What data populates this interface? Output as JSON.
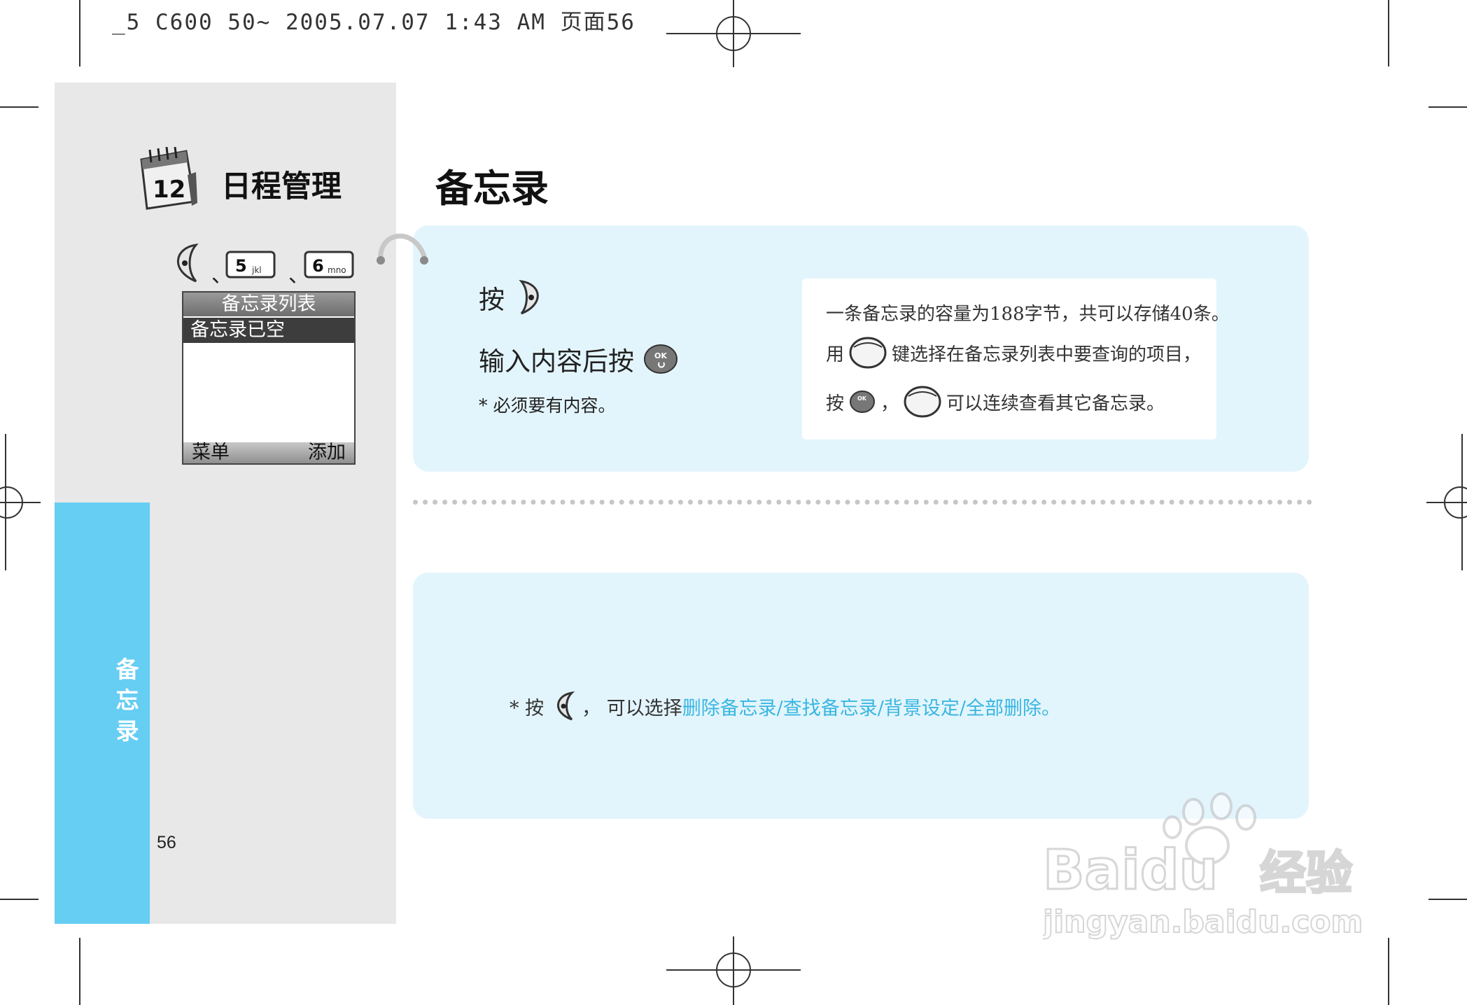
{
  "print_header": "_5 C600 50~ 2005.07.07 1:43 AM 页面56",
  "sidebar": {
    "section_title": "日程管理",
    "calendar_day": "12",
    "tab_label": "备\n忘\n录",
    "page_number": "56",
    "key_sequence": {
      "key1_digit": "5",
      "key1_letters": "jkl",
      "key2_digit": "6",
      "key2_letters": "mno",
      "separator": "、"
    }
  },
  "phone_screen": {
    "title": "备忘录列表",
    "selected_item": "备忘录已空",
    "soft_left": "菜单",
    "soft_right": "添加"
  },
  "main": {
    "title": "备忘录",
    "step1_prefix": "按",
    "step2_prefix": "输入内容后按",
    "note_required": "* 必须要有内容。",
    "ok_label": "OK",
    "info": {
      "line1": "一条备忘录的容量为188字节，共可以存储40条。",
      "line2_prefix": "用",
      "line2_suffix": "键选择在备忘录列表中要查询的项目，",
      "line3_prefix": "按",
      "line3_sep": "，",
      "line3_suffix": "可以连续查看其它备忘录。"
    },
    "bottom_note_prefix": "* 按",
    "bottom_note_mid": "， 可以选择",
    "bottom_note_options": "删除备忘录/查找备忘录/背景设定/全部删除。"
  },
  "watermark": {
    "brand": "Baidu",
    "brand_suffix": "经验",
    "url": "jingyan.baidu.com"
  },
  "colors": {
    "sidebar_tab": "#66cdf3",
    "panel_bg": "#e3f5fc",
    "link": "#39b6e1",
    "left_panel": "#e8e8e8"
  }
}
